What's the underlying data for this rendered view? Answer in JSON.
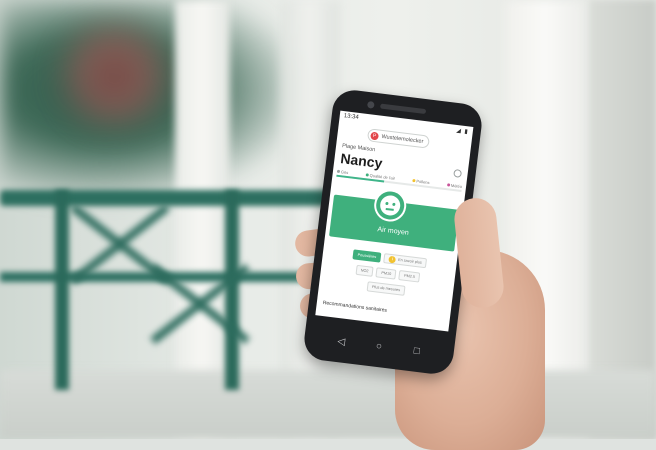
{
  "phone": {
    "statusbar": {
      "time": "13:34",
      "icons": "◢ ▮"
    },
    "brand": {
      "logo_glyph": "P",
      "label": "Wustelemolecker"
    },
    "subtitle": "Plage Maison",
    "user_name": "Nancy",
    "tabs": [
      {
        "label": "Gris",
        "color": "#9aa0a0"
      },
      {
        "label": "Qualité de l'air",
        "color": "#3fb07d"
      },
      {
        "label": "Pollens",
        "color": "#f2c230"
      },
      {
        "label": "Météo",
        "color": "#c8559a"
      }
    ],
    "progress_fraction": 0.38,
    "status": {
      "label": "Air moyen",
      "color": "#3fb07d"
    },
    "chips_row1": [
      {
        "label": "Poussières",
        "active": true
      },
      {
        "label": "En savoir plus",
        "active": false,
        "info": "i"
      }
    ],
    "chips_row2": [
      {
        "label": "NO2"
      },
      {
        "label": "PM10"
      },
      {
        "label": "PM2.5"
      }
    ],
    "chips_row3": [
      {
        "label": "Plus de mesures"
      }
    ],
    "footer": "Recommandations sanitaires",
    "nav": {
      "back": "◁",
      "home": "○",
      "recents": "□"
    }
  }
}
